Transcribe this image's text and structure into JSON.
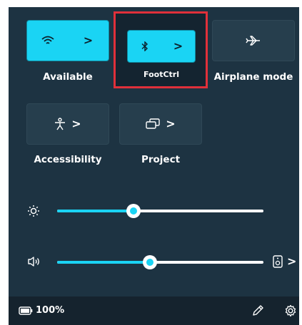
{
  "colors": {
    "panel_bg": "#1d3342",
    "active_tile": "#1ad4f4",
    "inactive_tile": "#263e4d",
    "highlight": "#e0303a"
  },
  "tiles": {
    "wifi": {
      "label": "Available",
      "active": true,
      "icon": "wifi-icon",
      "chevron": ">"
    },
    "bluetooth": {
      "label": "FootCtrl",
      "active": true,
      "icon": "bluetooth-icon",
      "chevron": ">"
    },
    "airplane": {
      "label": "Airplane mode",
      "active": false,
      "icon": "airplane-icon"
    },
    "accessibility": {
      "label": "Accessibility",
      "active": false,
      "icon": "accessibility-icon",
      "chevron": ">"
    },
    "project": {
      "label": "Project",
      "active": false,
      "icon": "project-icon",
      "chevron": ">"
    }
  },
  "sliders": {
    "brightness": {
      "icon": "brightness-icon",
      "value_percent": 37
    },
    "volume": {
      "icon": "speaker-icon",
      "value_percent": 45,
      "output_icon": "speaker-device-icon",
      "output_chevron": ">"
    }
  },
  "footer": {
    "battery_icon": "battery-icon",
    "battery_text": "100%",
    "edit_icon": "pencil-icon",
    "settings_icon": "gear-icon"
  }
}
